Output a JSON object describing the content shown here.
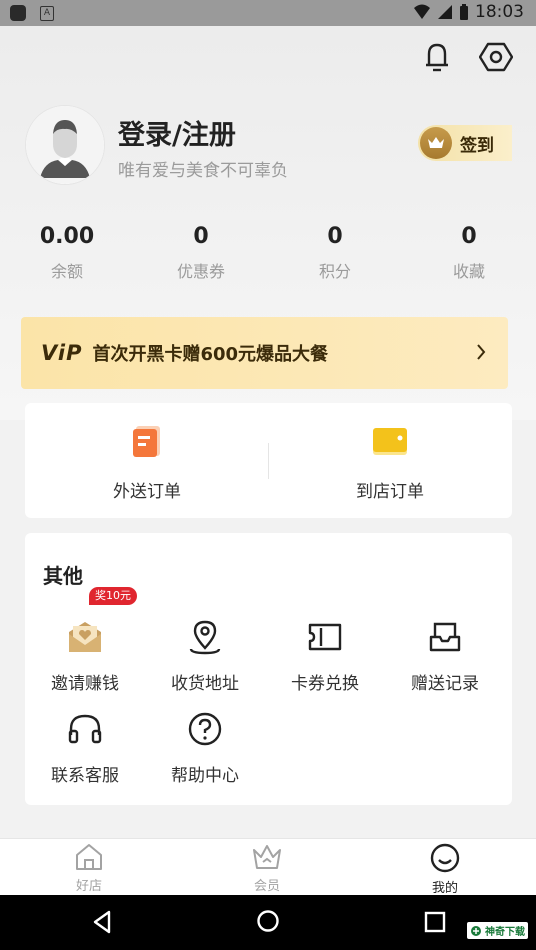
{
  "status_bar": {
    "time": "18:03",
    "small_icon_letter": "A"
  },
  "profile": {
    "title": "登录/注册",
    "subtitle": "唯有爱与美食不可辜负",
    "checkin_label": "签到"
  },
  "stats": [
    {
      "value": "0.00",
      "label": "余额"
    },
    {
      "value": "0",
      "label": "优惠券"
    },
    {
      "value": "0",
      "label": "积分"
    },
    {
      "value": "0",
      "label": "收藏"
    }
  ],
  "vip_banner": {
    "logo": "ViP",
    "text": "首次开黑卡赠600元爆品大餐"
  },
  "orders": [
    {
      "label": "外送订单",
      "icon": "takeout-order-icon",
      "color": "#f4773b"
    },
    {
      "label": "到店订单",
      "icon": "instore-order-icon",
      "color": "#f3c21b"
    }
  ],
  "other": {
    "title": "其他",
    "items": [
      {
        "label": "邀请赚钱",
        "icon": "invite-envelope-icon",
        "badge": "奖10元"
      },
      {
        "label": "收货地址",
        "icon": "location-pin-icon"
      },
      {
        "label": "卡券兑换",
        "icon": "coupon-icon"
      },
      {
        "label": "赠送记录",
        "icon": "gift-record-icon"
      },
      {
        "label": "联系客服",
        "icon": "headset-icon"
      },
      {
        "label": "帮助中心",
        "icon": "help-icon"
      }
    ]
  },
  "tabs": [
    {
      "label": "好店",
      "icon": "home-icon",
      "active": false
    },
    {
      "label": "会员",
      "icon": "crown-icon",
      "active": false
    },
    {
      "label": "我的",
      "icon": "smile-icon",
      "active": true
    }
  ],
  "watermark": "神奇下载",
  "colors": {
    "accent_gold": "#fbe4a8",
    "badge_red": "#e0262f",
    "text_dark": "#222222",
    "text_gray": "#9b9b9b"
  }
}
